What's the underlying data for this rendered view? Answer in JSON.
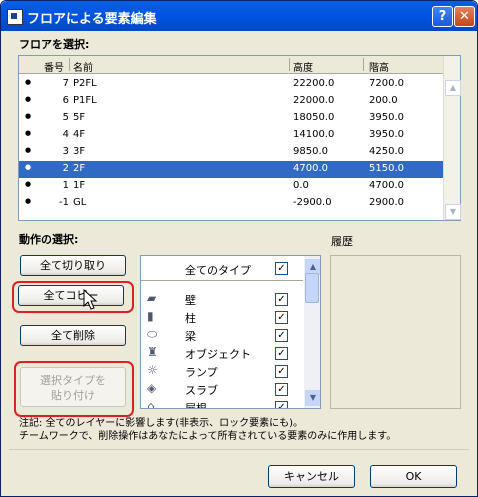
{
  "window": {
    "title": "フロアによる要素編集"
  },
  "floor_section": {
    "label": "フロアを選択:"
  },
  "floor_table": {
    "headers": [
      "番号",
      "名前",
      "高度",
      "階高"
    ],
    "rows": [
      {
        "bullet": "●",
        "num": "7",
        "name": "P2FL",
        "elev": "22200.0",
        "height": "7200.0",
        "selected": false
      },
      {
        "bullet": "●",
        "num": "6",
        "name": "P1FL",
        "elev": "22000.0",
        "height": "200.0",
        "selected": false
      },
      {
        "bullet": "●",
        "num": "5",
        "name": "5F",
        "elev": "18050.0",
        "height": "3950.0",
        "selected": false
      },
      {
        "bullet": "●",
        "num": "4",
        "name": "4F",
        "elev": "14100.0",
        "height": "3950.0",
        "selected": false
      },
      {
        "bullet": "●",
        "num": "3",
        "name": "3F",
        "elev": "9850.0",
        "height": "4250.0",
        "selected": false
      },
      {
        "bullet": "●",
        "num": "2",
        "name": "2F",
        "elev": "4700.0",
        "height": "5150.0",
        "selected": true
      },
      {
        "bullet": "●",
        "num": "1",
        "name": "1F",
        "elev": "0.0",
        "height": "4700.0",
        "selected": false
      },
      {
        "bullet": "●",
        "num": "-1",
        "name": "GL",
        "elev": "-2900.0",
        "height": "2900.0",
        "selected": false
      }
    ]
  },
  "action_section": {
    "label": "動作の選択:"
  },
  "history_section": {
    "label": "履歴"
  },
  "buttons": {
    "cut_all": "全て切り取り",
    "copy_all": "全てコピー",
    "delete_all": "全て削除",
    "paste_selected_line1": "選択タイプを",
    "paste_selected_line2": "貼り付け",
    "cancel": "キャンセル",
    "ok": "OK"
  },
  "types_list": {
    "header": "全てのタイプ",
    "header_checked": "✓",
    "items": [
      {
        "icon": "wall-icon",
        "glyph": "▰",
        "label": "壁",
        "checked": "✓"
      },
      {
        "icon": "column-icon",
        "glyph": "▮",
        "label": "柱",
        "checked": "✓"
      },
      {
        "icon": "beam-icon",
        "glyph": "⬭",
        "label": "梁",
        "checked": "✓"
      },
      {
        "icon": "object-icon",
        "glyph": "♜",
        "label": "オブジェクト",
        "checked": "✓"
      },
      {
        "icon": "lamp-icon",
        "glyph": "☼",
        "label": "ランプ",
        "checked": "✓"
      },
      {
        "icon": "slab-icon",
        "glyph": "◈",
        "label": "スラブ",
        "checked": "✓"
      },
      {
        "icon": "roof-icon",
        "glyph": "⌂",
        "label": "屋根",
        "checked": "✓"
      }
    ]
  },
  "notes": {
    "line1": "注記: 全てのレイヤーに影響します(非表示、ロック要素にも)。",
    "line2": "チームワークで、削除操作はあなたによって所有されている要素のみに作用します。"
  },
  "colors": {
    "titlebar": "#0054e3",
    "selection": "#316ac5",
    "highlight_box": "#e02020"
  }
}
